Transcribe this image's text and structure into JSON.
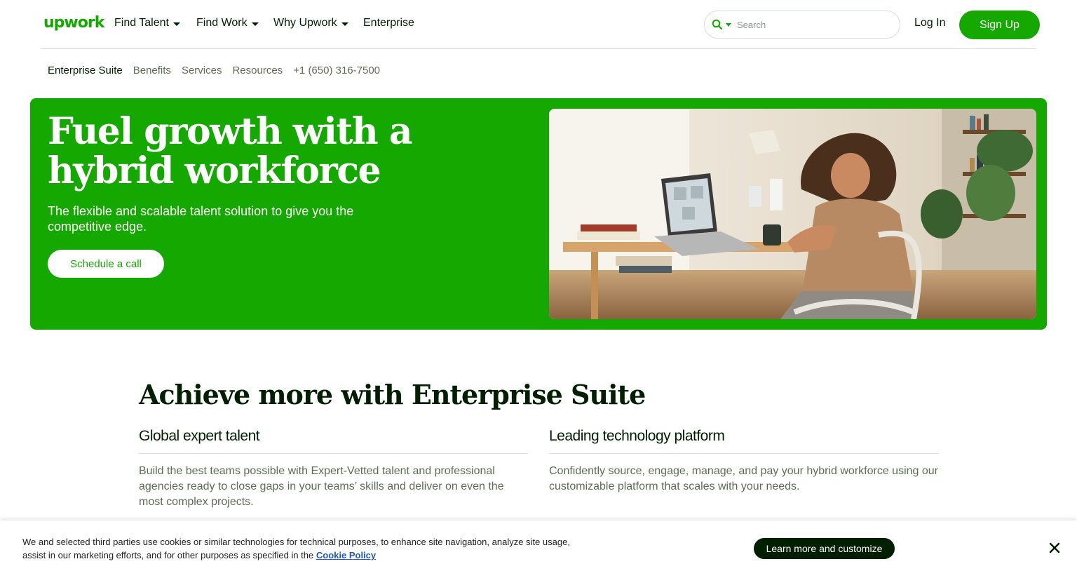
{
  "brand": {
    "logo_text": "upwork",
    "accent_color": "#14a800",
    "dark_color": "#001e00"
  },
  "nav": {
    "items": [
      {
        "label": "Find Talent",
        "has_dropdown": true
      },
      {
        "label": "Find Work",
        "has_dropdown": true
      },
      {
        "label": "Why Upwork",
        "has_dropdown": true
      },
      {
        "label": "Enterprise",
        "has_dropdown": false
      }
    ],
    "search_placeholder": "Search",
    "login_label": "Log In",
    "signup_label": "Sign Up"
  },
  "subnav": {
    "items": [
      "Enterprise Suite",
      "Benefits",
      "Services",
      "Resources",
      "+1 (650) 316-7500"
    ]
  },
  "hero": {
    "title": "Fuel growth with a hybrid workforce",
    "subtitle": "The flexible and scalable talent solution to give you the competitive edge.",
    "cta_label": "Schedule a call",
    "image_icon": "woman-at-desk-video-call-photo"
  },
  "achieve": {
    "title": "Achieve more with Enterprise Suite",
    "columns": [
      {
        "heading": "Global expert talent",
        "body": "Build the best teams possible with Expert-Vetted talent and professional agencies ready to close gaps in your teams’ skills and deliver on even the most complex projects."
      },
      {
        "heading": "Leading technology platform",
        "body": "Confidently source, engage, manage, and pay your hybrid workforce using our customizable platform that scales with your needs."
      }
    ]
  },
  "cookie": {
    "text": "We and selected third parties use cookies or similar technologies for technical purposes, to enhance site navigation, analyze site usage, assist in our marketing efforts, and for other purposes as specified in the",
    "link_label": "Cookie Policy",
    "button_label": "Learn more and customize"
  }
}
